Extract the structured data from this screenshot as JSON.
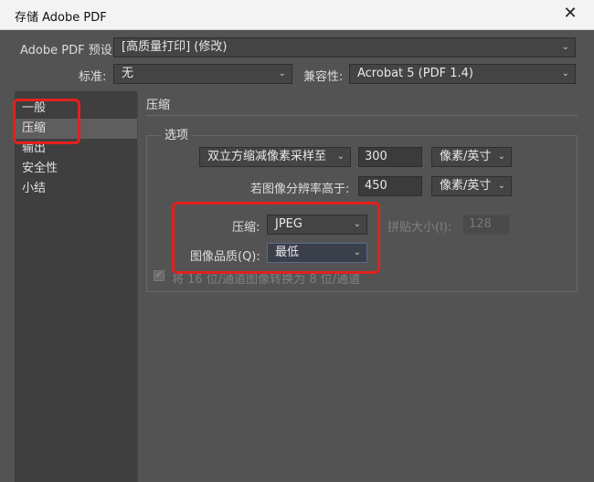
{
  "window": {
    "title": "存储 Adobe PDF",
    "close_glyph": "✕"
  },
  "preset": {
    "label": "Adobe PDF 预设:",
    "value": "[高质量打印] (修改)"
  },
  "standard": {
    "label": "标准:",
    "value": "无"
  },
  "compat": {
    "label": "兼容性:",
    "value": "Acrobat 5 (PDF 1.4)"
  },
  "sidebar": {
    "items": [
      {
        "label": "一般"
      },
      {
        "label": "压缩"
      },
      {
        "label": "输出"
      },
      {
        "label": "安全性"
      },
      {
        "label": "小结"
      }
    ],
    "selected": "压缩"
  },
  "section": {
    "title": "压缩",
    "group_title": "选项"
  },
  "downsample": {
    "method": "双立方缩减像素采样至",
    "value": "300",
    "unit": "像素/英寸",
    "above_label": "若图像分辨率高于:",
    "above_value": "450",
    "above_unit": "像素/英寸"
  },
  "compression": {
    "label": "压缩:",
    "value": "JPEG",
    "tile_label": "拼贴大小(I):",
    "tile_value": "128",
    "quality_label": "图像品质(Q):",
    "quality_value": "最低"
  },
  "convert16": {
    "label": "将 16 位/通道图像转换为 8 位/通道",
    "checked_glyph": "✓"
  },
  "icons": {
    "chevron": "chevron-down-icon",
    "close": "close-icon",
    "check": "check-icon"
  },
  "colors": {
    "highlight": "#e2211c",
    "panel": "#535353",
    "sidebar": "#3f3f3f"
  }
}
